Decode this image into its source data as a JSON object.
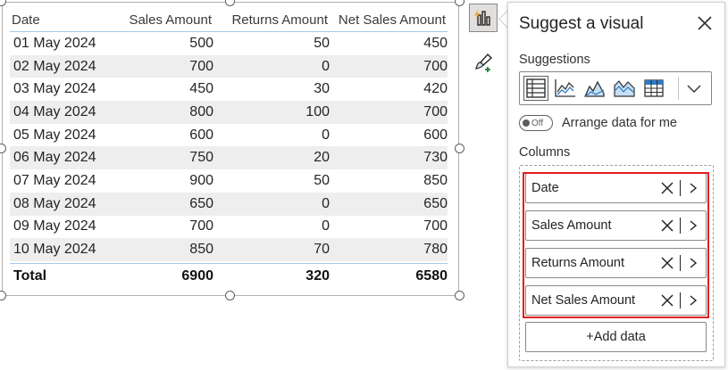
{
  "table": {
    "headers": {
      "date": "Date",
      "sales": "Sales Amount",
      "returns": "Returns Amount",
      "net": "Net Sales Amount"
    },
    "rows": [
      {
        "date": "01 May 2024",
        "sales": "500",
        "returns": "50",
        "net": "450"
      },
      {
        "date": "02 May 2024",
        "sales": "700",
        "returns": "0",
        "net": "700"
      },
      {
        "date": "03 May 2024",
        "sales": "450",
        "returns": "30",
        "net": "420"
      },
      {
        "date": "04 May 2024",
        "sales": "800",
        "returns": "100",
        "net": "700"
      },
      {
        "date": "05 May 2024",
        "sales": "600",
        "returns": "0",
        "net": "600"
      },
      {
        "date": "06 May 2024",
        "sales": "750",
        "returns": "20",
        "net": "730"
      },
      {
        "date": "07 May 2024",
        "sales": "900",
        "returns": "50",
        "net": "850"
      },
      {
        "date": "08 May 2024",
        "sales": "650",
        "returns": "0",
        "net": "650"
      },
      {
        "date": "09 May 2024",
        "sales": "700",
        "returns": "0",
        "net": "700"
      },
      {
        "date": "10 May 2024",
        "sales": "850",
        "returns": "70",
        "net": "780"
      }
    ],
    "total": {
      "label": "Total",
      "sales": "6900",
      "returns": "320",
      "net": "6580"
    }
  },
  "toolbar": {
    "active_icon": "suggest-visual-icon",
    "format_icon": "format-brush-icon"
  },
  "panel": {
    "title": "Suggest a visual",
    "suggestions_label": "Suggestions",
    "suggestion_icons": [
      "table-icon",
      "line-chart-icon",
      "area-chart-icon",
      "stacked-area-icon",
      "matrix-icon"
    ],
    "toggle_state": "Off",
    "toggle_label": "Arrange data for me",
    "columns_label": "Columns",
    "columns": [
      "Date",
      "Sales Amount",
      "Returns Amount",
      "Net Sales Amount"
    ],
    "add_data_label": "+Add data",
    "highlight_color": "#e02020"
  }
}
